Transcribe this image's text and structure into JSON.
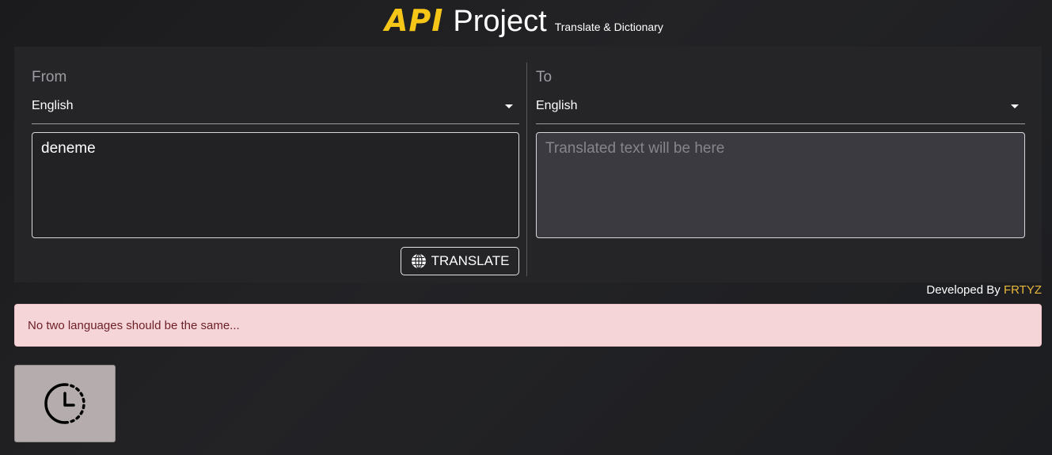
{
  "header": {
    "brand_api": "API",
    "brand_project": "Project",
    "subtitle": "Translate & Dictionary"
  },
  "from": {
    "label": "From",
    "language": "English",
    "text": "deneme"
  },
  "to": {
    "label": "To",
    "language": "English",
    "placeholder": "Translated text will be here"
  },
  "actions": {
    "translate_label": "TRANSLATE"
  },
  "footer": {
    "developed_by": "Developed By",
    "developer": "FRTYZ"
  },
  "alert": {
    "message": "No two languages should be the same..."
  },
  "icons": {
    "translate": "globe-icon",
    "history": "history-clock-icon"
  },
  "colors": {
    "brand_accent": "#f5c518",
    "developer_name": "#e7b93c",
    "alert_bg": "#f6d5d9",
    "alert_text": "#6b1f27"
  }
}
